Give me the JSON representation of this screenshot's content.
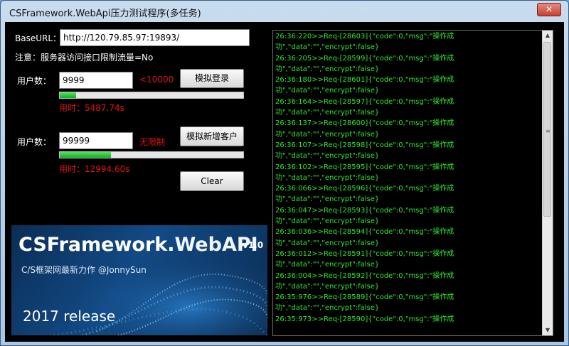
{
  "window": {
    "title": "CSFramework.WebApi压力测试程序(多任务)",
    "close_label": "✕"
  },
  "base_url": {
    "label": "BaseURL：",
    "value": "http://120.79.85.97:19893/"
  },
  "notice": "注意：服务器访问接口限制流量=No",
  "login_section": {
    "users_label": "用户数：",
    "users_value": "9999",
    "limit_text": "<10000",
    "button_label": "模拟登录",
    "progress_fraction": 0.09,
    "elapsed_text": "用时：5487.74s"
  },
  "customer_section": {
    "users_label": "用户数：",
    "users_value": "99999",
    "limit_text": "无限制",
    "button_label": "模拟新增客户",
    "progress_fraction": 0.28,
    "elapsed_text": "用时：12994.60s"
  },
  "clear_button": "Clear",
  "banner": {
    "title_part1": "CSFramework.",
    "title_part2": "WebAPI",
    "version": "v1.0",
    "subtitle": "C/S框架网最新力作 @JonnySun",
    "release": "2017 release"
  },
  "log_lines": [
    "26:36:220>>Req-[28603]{\"code\":0,\"msg\":\"操作成",
    "功\",\"data\":\"\",\"encrypt\":false}",
    "26:36:205>>Req-[28599]{\"code\":0,\"msg\":\"操作成",
    "功\",\"data\":\"\",\"encrypt\":false}",
    "26:36:180>>Req-[28601]{\"code\":0,\"msg\":\"操作成",
    "功\",\"data\":\"\",\"encrypt\":false}",
    "26:36:164>>Req-[28597]{\"code\":0,\"msg\":\"操作成",
    "功\",\"data\":\"\",\"encrypt\":false}",
    "26:36:137>>Req-[28600]{\"code\":0,\"msg\":\"操作成",
    "功\",\"data\":\"\",\"encrypt\":false}",
    "26:36:107>>Req-[28598]{\"code\":0,\"msg\":\"操作成",
    "功\",\"data\":\"\",\"encrypt\":false}",
    "26:36:102>>Req-[28595]{\"code\":0,\"msg\":\"操作成",
    "功\",\"data\":\"\",\"encrypt\":false}",
    "26:36:066>>Req-[28596]{\"code\":0,\"msg\":\"操作成",
    "功\",\"data\":\"\",\"encrypt\":false}",
    "26:36:047>>Req-[28593]{\"code\":0,\"msg\":\"操作成",
    "功\",\"data\":\"\",\"encrypt\":false}",
    "26:36:036>>Req-[28594]{\"code\":0,\"msg\":\"操作成",
    "功\",\"data\":\"\",\"encrypt\":false}",
    "26:36:012>>Req-[28591]{\"code\":0,\"msg\":\"操作成",
    "功\",\"data\":\"\",\"encrypt\":false}",
    "26:36:004>>Req-[28592]{\"code\":0,\"msg\":\"操作成",
    "功\",\"data\":\"\",\"encrypt\":false}",
    "26:35:976>>Req-[28589]{\"code\":0,\"msg\":\"操作成",
    "功\",\"data\":\"\",\"encrypt\":false}",
    "26:35:973>>Req-[28590]{\"code\":0,\"msg\":\"操作成"
  ],
  "scrollbar": {
    "up_icon": "up-arrow-icon",
    "down_icon": "down-arrow-icon",
    "grip": "≡"
  },
  "colors": {
    "log_text": "#2ee62e",
    "warning": "#e01515",
    "progress_fill": "#06b025"
  }
}
